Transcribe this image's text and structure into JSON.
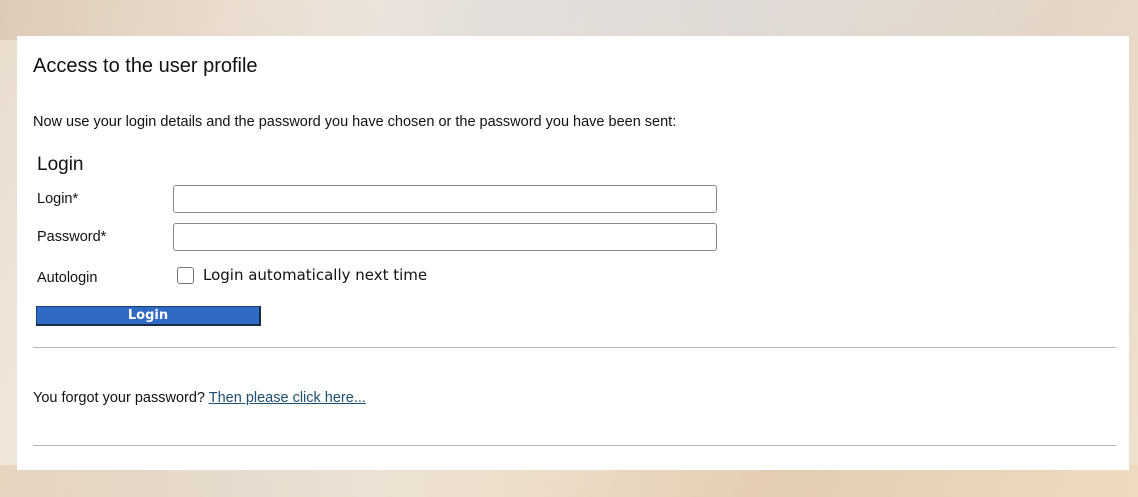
{
  "page": {
    "title": "Access to the user profile",
    "intro": "Now use your login details and the password you have chosen or the password you have been sent:"
  },
  "login_form": {
    "heading": "Login",
    "fields": {
      "login": {
        "label": "Login*",
        "value": ""
      },
      "password": {
        "label": "Password*",
        "value": ""
      }
    },
    "autologin": {
      "label": "Autologin",
      "checkbox_label": "Login automatically next time",
      "checked": false
    },
    "submit_label": "Login"
  },
  "forgot_password": {
    "text": "You forgot your password?",
    "link_text": "Then please click here..."
  },
  "colors": {
    "button_bg": "#2f6bc4",
    "link": "#1d4f73",
    "panel_bg": "#ffffff"
  }
}
